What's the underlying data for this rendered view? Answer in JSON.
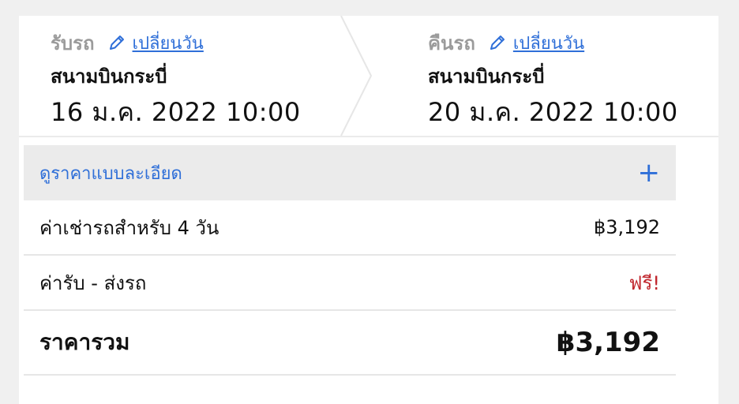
{
  "pickup": {
    "label": "รับรถ",
    "change_label": "เปลี่ยนวัน",
    "location": "สนามบินกระบี่",
    "datetime": "16 ม.ค. 2022 10:00"
  },
  "return": {
    "label": "คืนรถ",
    "change_label": "เปลี่ยนวัน",
    "location": "สนามบินกระบี่",
    "datetime": "20 ม.ค. 2022 10:00"
  },
  "price": {
    "detail_label": "ดูราคาแบบละเอียด",
    "expand_icon": "plus-icon",
    "lines": [
      {
        "label": "ค่าเช่ารถสำหรับ 4 วัน",
        "value": "฿3,192"
      },
      {
        "label": "ค่ารับ - ส่งรถ",
        "value": "ฟรี!"
      }
    ],
    "total_label": "ราคารวม",
    "total_value": "฿3,192"
  },
  "colors": {
    "link": "#2f6fd8",
    "free": "#c0262d",
    "muted": "#9b9b9b",
    "detail_bg": "#ebebeb"
  }
}
